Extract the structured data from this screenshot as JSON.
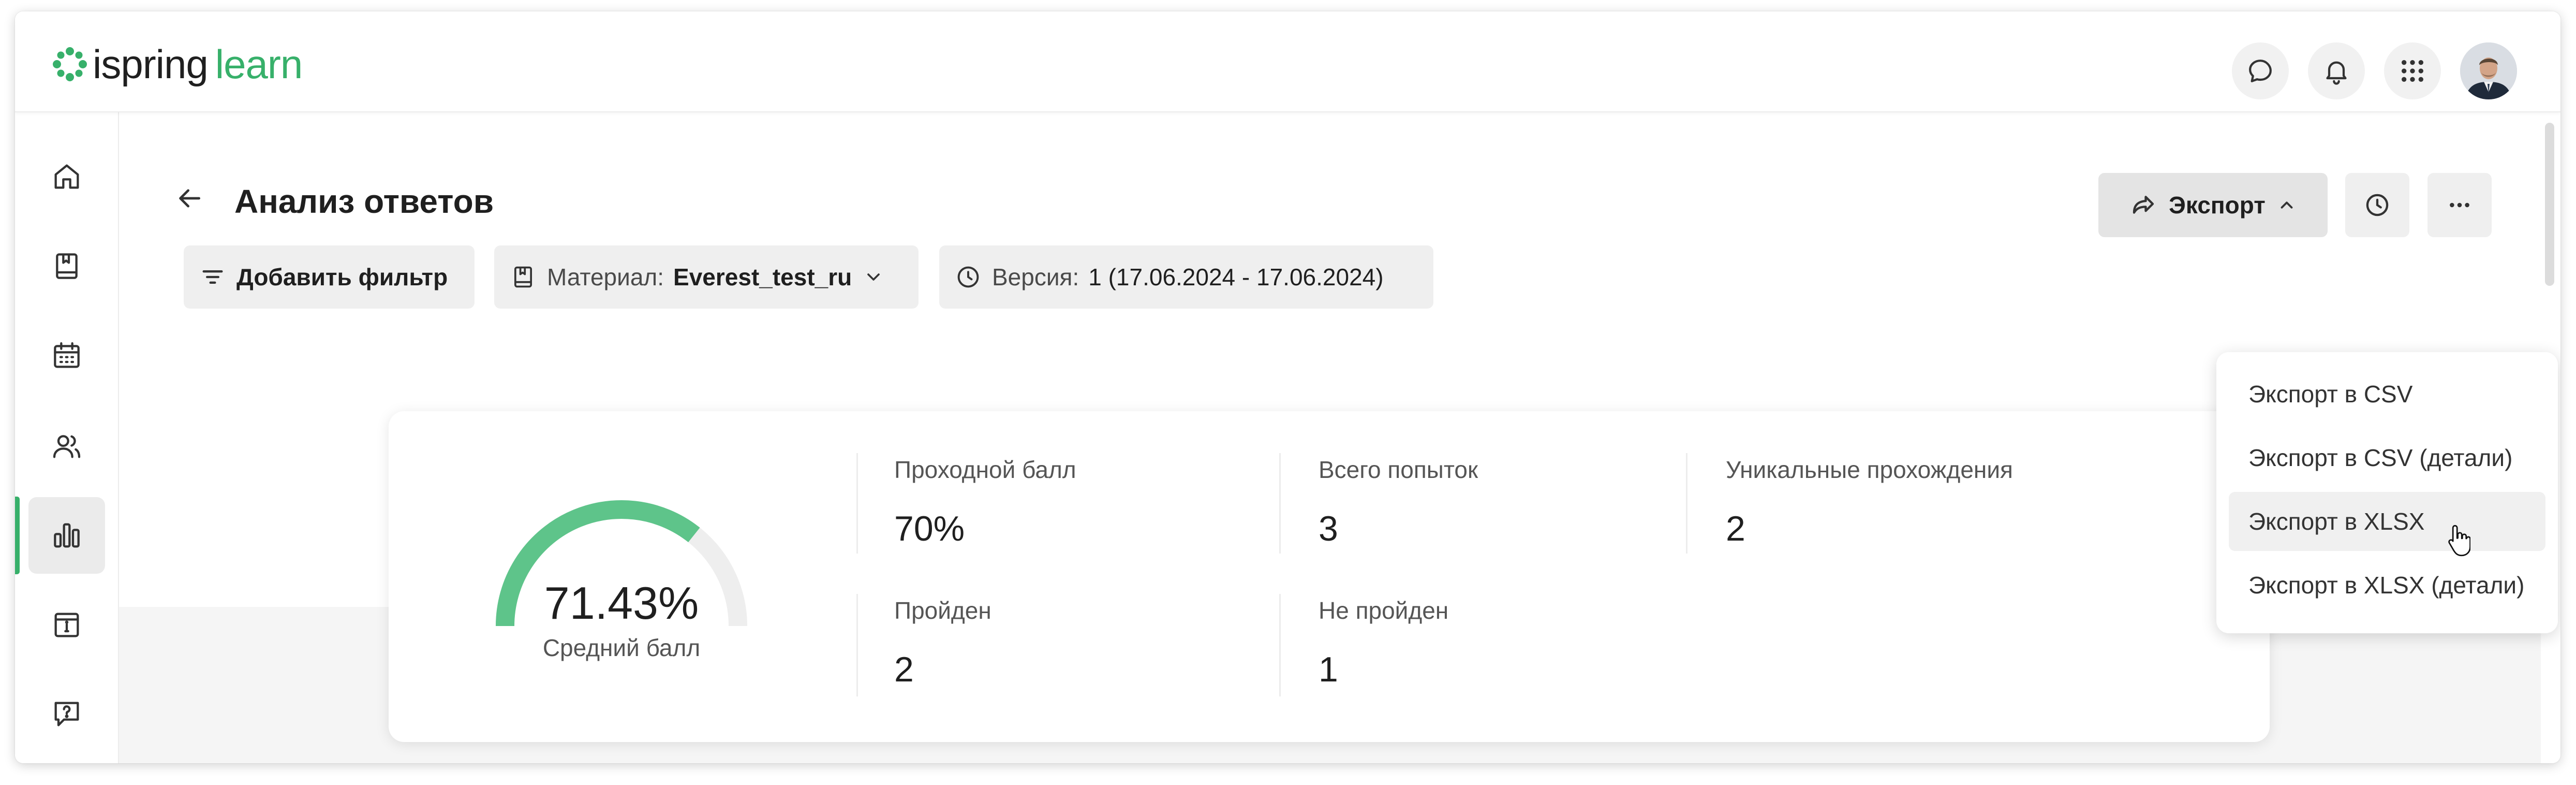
{
  "app": {
    "logo_part1": "ispring",
    "logo_part2": "learn",
    "brand_color": "#37b06a"
  },
  "header": {
    "icons": [
      "chat-icon",
      "bell-icon",
      "apps-grid-icon",
      "user-avatar"
    ]
  },
  "sidebar": {
    "items": [
      {
        "icon": "home-icon"
      },
      {
        "icon": "catalog-book-icon"
      },
      {
        "icon": "calendar-icon"
      },
      {
        "icon": "users-icon"
      },
      {
        "icon": "reports-chart-icon",
        "active": true
      },
      {
        "icon": "info-calendar-icon"
      },
      {
        "icon": "help-question-icon"
      }
    ]
  },
  "page": {
    "title": "Анализ ответов"
  },
  "filters": {
    "add_filter_label": "Добавить фильтр",
    "material_label": "Материал:",
    "material_value": "Everest_test_ru",
    "version_label": "Версия:",
    "version_value": "1 (17.06.2024 - 17.06.2024)"
  },
  "toolbar": {
    "export_label": "Экспорт"
  },
  "export_menu": {
    "items": [
      {
        "label": "Экспорт в CSV"
      },
      {
        "label": "Экспорт в CSV (детали)"
      },
      {
        "label": "Экспорт в XLSX",
        "hovered": true
      },
      {
        "label": "Экспорт в XLSX (детали)"
      }
    ]
  },
  "summary": {
    "average_score": "71.43%",
    "average_score_fraction": 0.7143,
    "average_label": "Средний балл",
    "stats": [
      {
        "label": "Проходной балл",
        "value": "70%"
      },
      {
        "label": "Всего попыток",
        "value": "3"
      },
      {
        "label": "Уникальные прохождения",
        "value": "2"
      },
      {
        "label": "Пройден",
        "value": "2"
      },
      {
        "label": "Не пройден",
        "value": "1"
      }
    ]
  }
}
